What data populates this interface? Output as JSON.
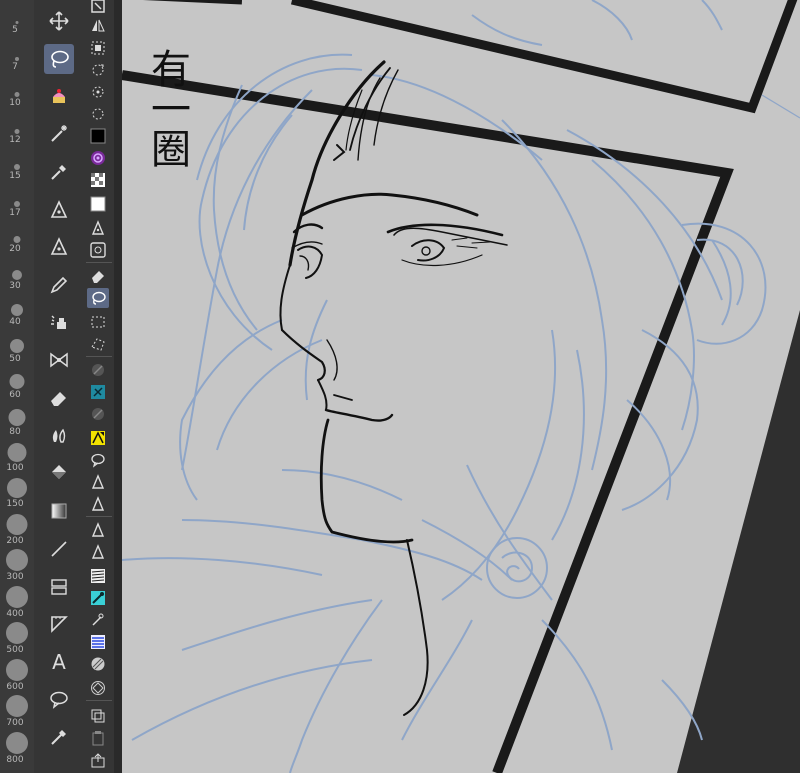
{
  "brush_sizes": [
    {
      "label": "5"
    },
    {
      "label": "7"
    },
    {
      "label": "10"
    },
    {
      "label": "12"
    },
    {
      "label": "15"
    },
    {
      "label": "17"
    },
    {
      "label": "20"
    },
    {
      "label": "30"
    },
    {
      "label": "40"
    },
    {
      "label": "50"
    },
    {
      "label": "60"
    },
    {
      "label": "80"
    },
    {
      "label": "100"
    },
    {
      "label": "150"
    },
    {
      "label": "200"
    },
    {
      "label": "300"
    },
    {
      "label": "400"
    },
    {
      "label": "500"
    },
    {
      "label": "600"
    },
    {
      "label": "700"
    },
    {
      "label": "800"
    }
  ],
  "tools": [
    {
      "name": "move-tool",
      "icon": "move-icon"
    },
    {
      "name": "lasso-select-tool",
      "icon": "lasso-icon",
      "active": true
    },
    {
      "name": "auto-select-tool",
      "icon": "cake-icon"
    },
    {
      "name": "magic-wand-tool",
      "icon": "wand-icon"
    },
    {
      "name": "eyedropper-tool",
      "icon": "eyedropper-icon"
    },
    {
      "name": "pen-tool",
      "icon": "pen-icon"
    },
    {
      "name": "pen-tool-2",
      "icon": "pen-icon"
    },
    {
      "name": "pencil-tool",
      "icon": "pencil-icon"
    },
    {
      "name": "brush-tool",
      "icon": "airbrush-icon"
    },
    {
      "name": "decoration-tool",
      "icon": "ribbon-icon"
    },
    {
      "name": "eraser-tool",
      "icon": "eraser-icon"
    },
    {
      "name": "blend-tool",
      "icon": "blend-icon"
    },
    {
      "name": "fill-tool",
      "icon": "fill-icon"
    },
    {
      "name": "gradient-tool",
      "icon": "gradient-icon"
    },
    {
      "name": "figure-tool",
      "icon": "line-icon"
    },
    {
      "name": "frame-border-tool",
      "icon": "frame-icon"
    },
    {
      "name": "ruler-tool",
      "icon": "ruler-icon"
    },
    {
      "name": "text-tool",
      "icon": "text-icon",
      "glyph": "A"
    },
    {
      "name": "balloon-tool",
      "icon": "balloon-icon"
    },
    {
      "name": "correct-line-tool",
      "icon": "correct-line-icon"
    }
  ],
  "colors": {
    "sketch": "#8fa6c8",
    "ink": "#111111",
    "paper": "#c4c4c4",
    "active_tool": "#5d6a86",
    "panel_dark": "#353535"
  },
  "canvas_text": {
    "vertical_chars": "有一圈"
  }
}
